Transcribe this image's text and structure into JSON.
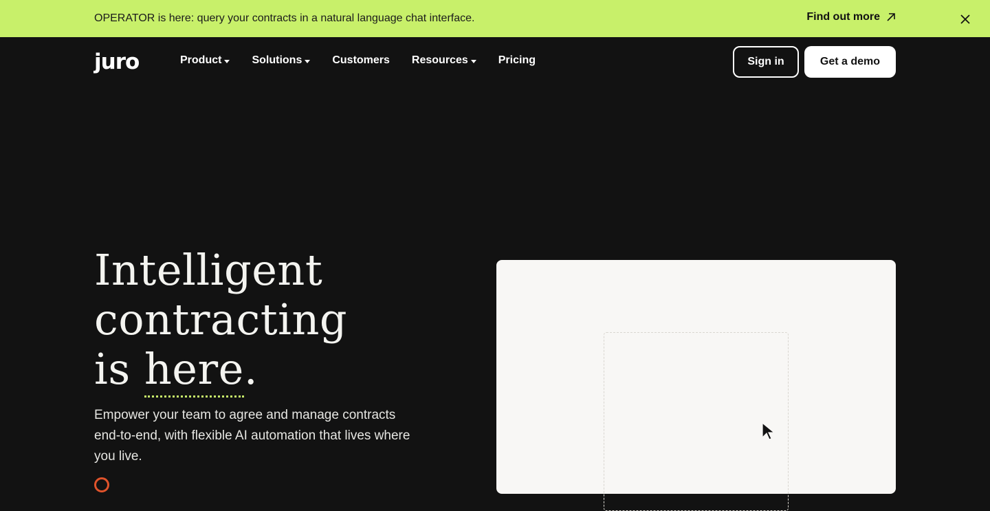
{
  "announcement": {
    "text": "OPERATOR is here: query your contracts in a natural language chat interface.",
    "link_label": "Find out more",
    "link_icon": "arrow-up-right-icon",
    "close_icon": "close-icon"
  },
  "nav": {
    "logo": "juro",
    "items": [
      {
        "label": "Product",
        "has_dropdown": true
      },
      {
        "label": "Solutions",
        "has_dropdown": true
      },
      {
        "label": "Customers",
        "has_dropdown": false
      },
      {
        "label": "Resources",
        "has_dropdown": true
      },
      {
        "label": "Pricing",
        "has_dropdown": false
      }
    ],
    "sign_in_label": "Sign in",
    "demo_label": "Get a demo"
  },
  "hero": {
    "title_line1": "Intelligent",
    "title_line2": "contracting",
    "title_line3_prefix": "is ",
    "title_line3_highlight": "here",
    "title_line3_suffix": ".",
    "subtitle": "Empower your team to agree and manage contracts end-to-end, with flexible AI automation that lives where you live."
  },
  "colors": {
    "background": "#121212",
    "accent": "#c8f06a",
    "panel": "#f8f7f5",
    "orange": "#e0532b"
  }
}
